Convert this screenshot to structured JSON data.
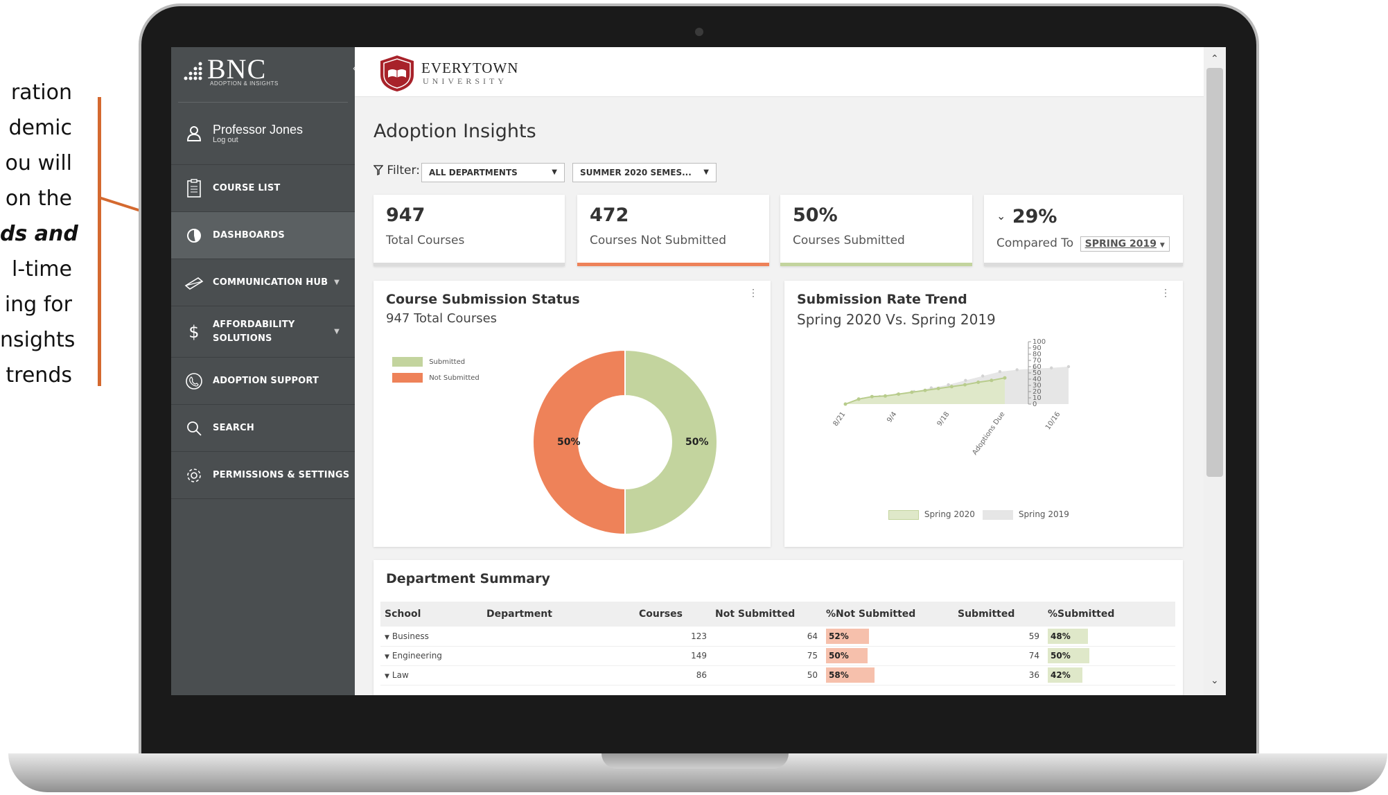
{
  "annotation": {
    "lines": [
      "ration",
      "demic",
      "ou will",
      "on the",
      "ds and",
      "l-time",
      "ing for",
      "nsights",
      "trends"
    ]
  },
  "sidebar": {
    "logo_text": "BNC",
    "logo_sub": "ADOPTION & INSIGHTS",
    "user": {
      "name": "Professor Jones",
      "logout": "Log out"
    },
    "items": [
      {
        "label": "COURSE LIST",
        "icon": "clipboard-icon"
      },
      {
        "label": "DASHBOARDS",
        "icon": "pie-chart-icon",
        "active": true
      },
      {
        "label": "COMMUNICATION HUB",
        "icon": "envelope-icon"
      },
      {
        "label": "AFFORDABILITY SOLUTIONS",
        "icon": "dollar-icon"
      },
      {
        "label": "ADOPTION SUPPORT",
        "icon": "phone-icon"
      },
      {
        "label": "SEARCH",
        "icon": "search-icon"
      },
      {
        "label": "PERMISSIONS & SETTINGS",
        "icon": "gear-icon"
      }
    ]
  },
  "header": {
    "university_name": "EVERYTOWN",
    "university_sub": "UNIVERSITY"
  },
  "page": {
    "title": "Adoption Insights",
    "filter_label": "Filter:",
    "filter_department": "ALL DEPARTMENTS",
    "filter_semester": "SUMMER 2020 SEMES..."
  },
  "kpis": {
    "total_courses": {
      "value": "947",
      "label": "Total Courses"
    },
    "not_submitted": {
      "value": "472",
      "label": "Courses Not Submitted"
    },
    "submitted": {
      "value": "50%",
      "label": "Courses Submitted"
    },
    "compared": {
      "value": "29%",
      "label": "Compared To",
      "term": "SPRING 2019"
    }
  },
  "colors": {
    "submitted": "#c3d49e",
    "not_submitted": "#ee8259",
    "accent": "#d4692f",
    "sidebar": "#4a4e50"
  },
  "status_card": {
    "title": "Course Submission Status",
    "subtitle": "947 Total Courses",
    "legend_submitted": "Submitted",
    "legend_not_submitted": "Not Submitted",
    "left_pct": "50%",
    "right_pct": "50%"
  },
  "trend_card": {
    "title": "Submission Rate Trend",
    "subtitle": "Spring 2020 Vs. Spring 2019",
    "legend_2020": "Spring 2020",
    "legend_2019": "Spring 2019"
  },
  "chart_data": [
    {
      "type": "pie",
      "title": "Course Submission Status",
      "categories": [
        "Submitted",
        "Not Submitted"
      ],
      "values": [
        50,
        50
      ],
      "labels": [
        "50%",
        "50%"
      ]
    },
    {
      "type": "area",
      "title": "Submission Rate Trend",
      "subtitle": "Spring 2020 Vs. Spring 2019",
      "x_tick_labels": [
        "8/21",
        "9/4",
        "9/18",
        "Adoptions Due",
        "10/16"
      ],
      "y_ticks": [
        0,
        10,
        20,
        30,
        40,
        50,
        60,
        70,
        80,
        90,
        100
      ],
      "ylim": [
        0,
        100
      ],
      "series": [
        {
          "name": "Spring 2020",
          "values": [
            0,
            8,
            12,
            13,
            16,
            19,
            22,
            25,
            28,
            31,
            35,
            38,
            42
          ]
        },
        {
          "name": "Spring 2019",
          "values": [
            0,
            8,
            12,
            15,
            20,
            26,
            31,
            38,
            45,
            52,
            55,
            57,
            58,
            60
          ]
        }
      ],
      "legend": "bottom"
    }
  ],
  "dept_summary": {
    "title": "Department Summary",
    "columns": [
      "School",
      "Department",
      "Courses",
      "Not Submitted",
      "%Not Submitted",
      "Submitted",
      "%Submitted"
    ],
    "rows": [
      {
        "school": "Business",
        "courses": "123",
        "not_submitted": "64",
        "pct_not": "52%",
        "pct_not_val": 52,
        "submitted": "59",
        "pct_sub": "48%",
        "pct_sub_val": 48
      },
      {
        "school": "Engineering",
        "courses": "149",
        "not_submitted": "75",
        "pct_not": "50%",
        "pct_not_val": 50,
        "submitted": "74",
        "pct_sub": "50%",
        "pct_sub_val": 50
      },
      {
        "school": "Law",
        "courses": "86",
        "not_submitted": "50",
        "pct_not": "58%",
        "pct_not_val": 58,
        "submitted": "36",
        "pct_sub": "42%",
        "pct_sub_val": 42
      }
    ]
  }
}
